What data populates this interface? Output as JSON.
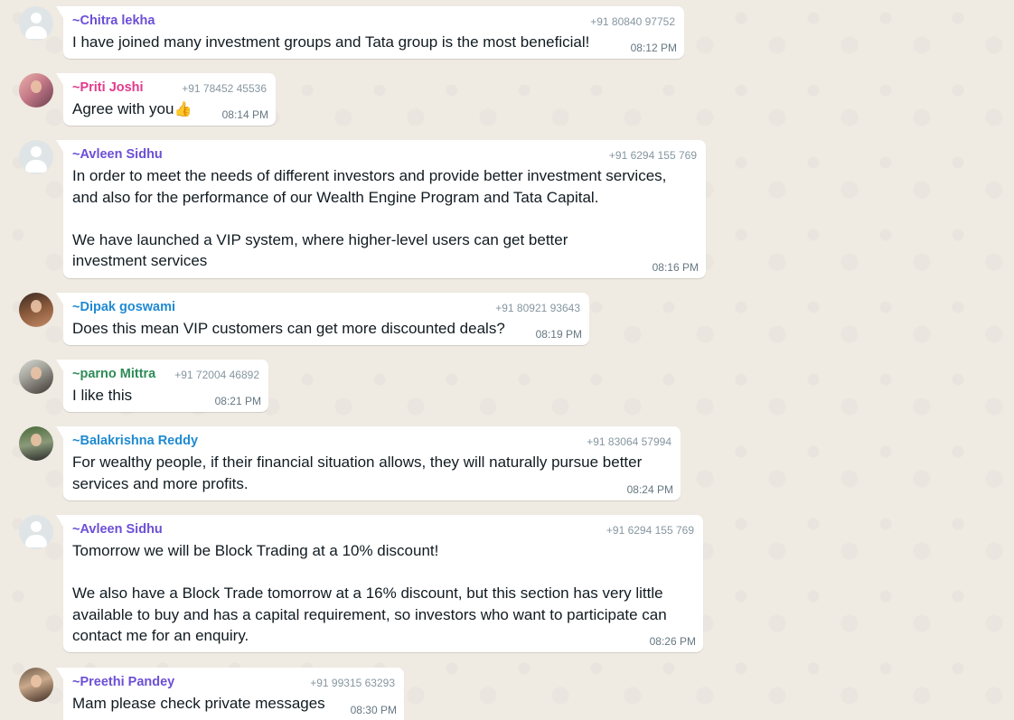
{
  "colors": {
    "chat_background": "#efeae2",
    "bubble_background": "#ffffff",
    "phone_gray": "#8696a0",
    "time_gray": "#667781"
  },
  "messages": [
    {
      "sender": "~Chitra lekha",
      "sender_color": "#6c4fd6",
      "phone": "+91 80840 97752",
      "text": "I have joined many investment groups and Tata group is the most beneficial!",
      "time": "08:12 PM",
      "avatar": "default-avatar"
    },
    {
      "sender": "~Priti Joshi",
      "sender_color": "#e23a8a",
      "phone": "+91 78452 45536",
      "text": "Agree with you",
      "emoji": "👍",
      "time": "08:14 PM",
      "avatar": "photo-avatar"
    },
    {
      "sender": "~Avleen Sidhu",
      "sender_color": "#6c4fd6",
      "phone": "+91 6294 155 769",
      "text": "In order to meet the needs of different investors and provide better investment services,\nand also for the performance of our Wealth Engine Program and Tata Capital.\n\nWe have launched a VIP system, where higher-level users can get better\ninvestment services",
      "time": "08:16 PM",
      "avatar": "default-avatar"
    },
    {
      "sender": "~Dipak goswami",
      "sender_color": "#1f8ad1",
      "phone": "+91 80921 93643",
      "text": "Does this mean VIP customers can get more discounted deals?",
      "time": "08:19 PM",
      "avatar": "photo-avatar"
    },
    {
      "sender": "~parno Mittra",
      "sender_color": "#2e8b57",
      "phone": "+91 72004 46892",
      "text": "I like this",
      "time": "08:21 PM",
      "avatar": "photo-avatar"
    },
    {
      "sender": "~Balakrishna Reddy",
      "sender_color": "#1f8ad1",
      "phone": "+91 83064 57994",
      "text": "For wealthy people, if their financial situation allows, they will naturally pursue better\nservices and more profits.",
      "time": "08:24 PM",
      "avatar": "photo-avatar"
    },
    {
      "sender": "~Avleen Sidhu",
      "sender_color": "#6c4fd6",
      "phone": "+91 6294 155 769",
      "text": "Tomorrow we will be Block Trading at a 10% discount!\n\nWe also have a Block Trade tomorrow at a 16% discount, but this section has very little\navailable to buy and has a capital requirement, so investors who want to participate can\ncontact me for an enquiry.",
      "time": "08:26 PM",
      "avatar": "default-avatar"
    },
    {
      "sender": "~Preethi Pandey",
      "sender_color": "#6c4fd6",
      "phone": "+91 99315 63293",
      "text": "Mam please check private messages",
      "time": "08:30 PM",
      "avatar": "photo-avatar"
    }
  ]
}
